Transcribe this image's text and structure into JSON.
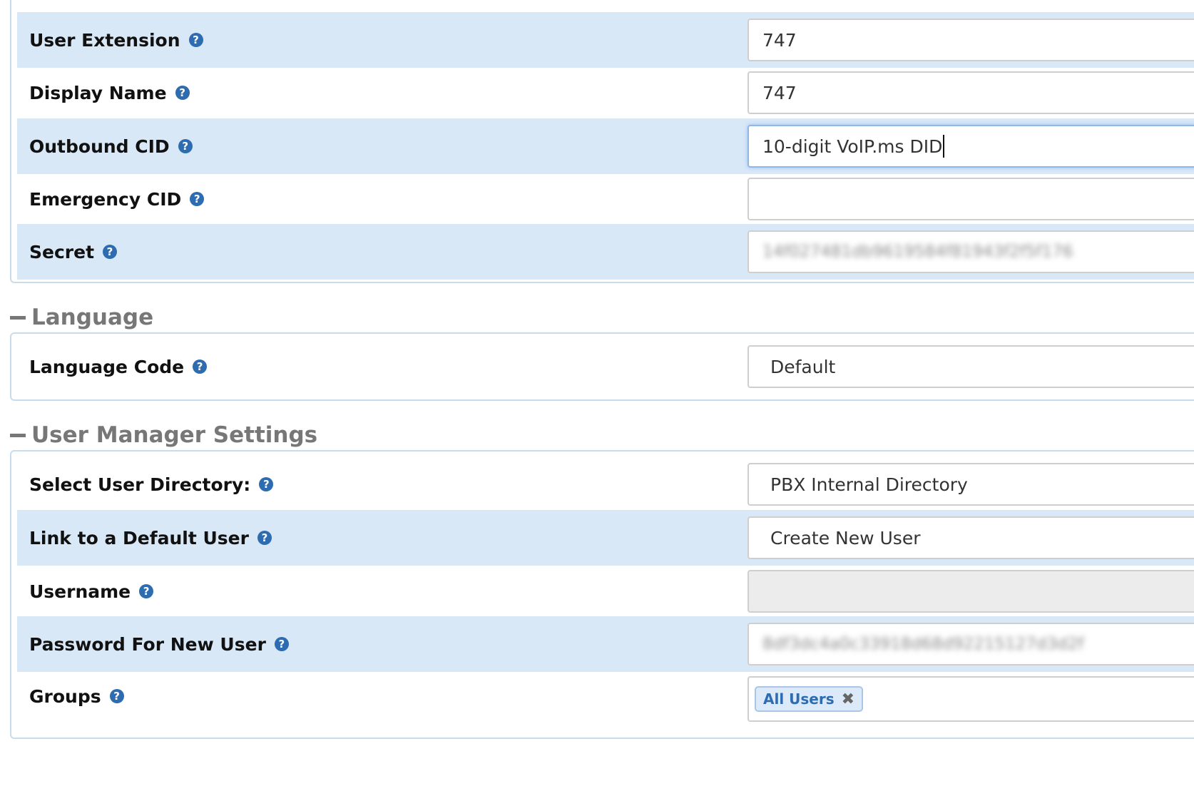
{
  "extension_panel": {
    "rows": [
      {
        "label": "User Extension",
        "value": "747"
      },
      {
        "label": "Display Name",
        "value": "747"
      },
      {
        "label": "Outbound CID",
        "value": "10-digit VoIP.ms DID"
      },
      {
        "label": "Emergency CID",
        "value": ""
      },
      {
        "label": "Secret",
        "value": "14f027481db9619584f81943f2f5f176"
      }
    ]
  },
  "language_section": {
    "title": "Language",
    "rows": [
      {
        "label": "Language Code",
        "value": "Default"
      }
    ]
  },
  "user_manager_section": {
    "title": "User Manager Settings",
    "rows": [
      {
        "label": "Select User Directory:",
        "value": "PBX Internal Directory"
      },
      {
        "label": "Link to a Default User",
        "value": "Create New User"
      },
      {
        "label": "Username",
        "value": ""
      },
      {
        "label": "Password For New User",
        "value": "8df3dc4a0c33918d68d92215127d3d2f"
      },
      {
        "label": "Groups",
        "tags": [
          "All Users"
        ]
      }
    ]
  },
  "icons": {
    "help": "question-circle-icon",
    "collapse": "minus-icon",
    "tag_remove": "close-x-icon"
  },
  "help_glyph": "?",
  "remove_glyph": "✖",
  "colors": {
    "row_shade": "#d9e8f7",
    "help_icon": "#2d6cb0",
    "panel_border": "#c9dcec",
    "section_title": "#777777"
  }
}
